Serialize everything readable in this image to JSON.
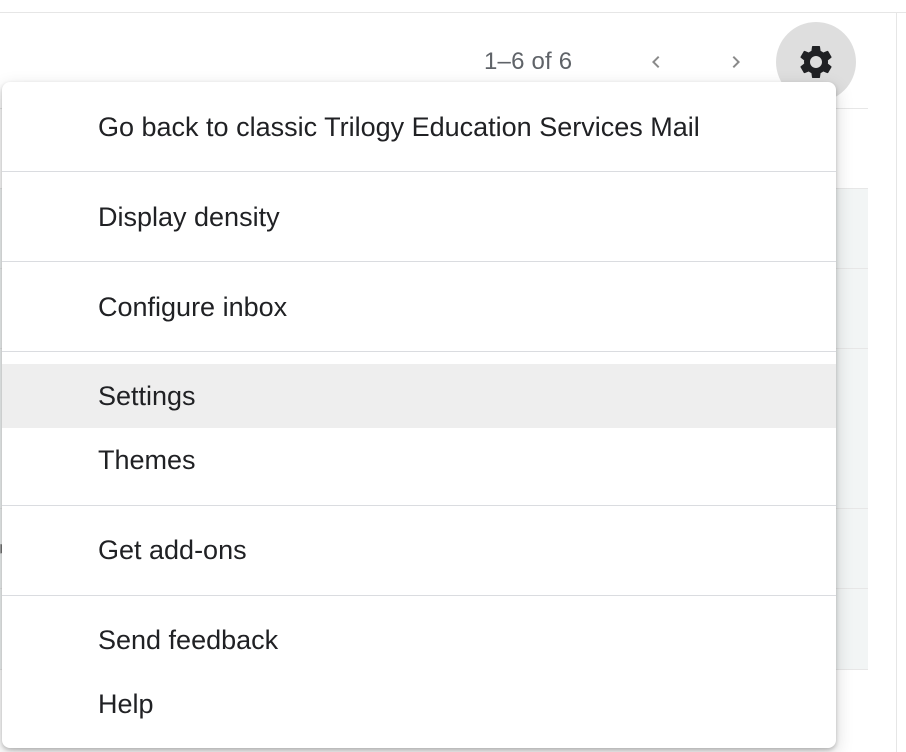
{
  "toolbar": {
    "pagination_label": "1–6 of 6",
    "prev_icon": "chevron-left-icon",
    "next_icon": "chevron-right-icon",
    "settings_icon": "gear-icon"
  },
  "settings_menu": {
    "items": [
      {
        "label": "Go back to classic Trilogy Education Services Mail"
      },
      {
        "label": "Display density"
      },
      {
        "label": "Configure inbox"
      },
      {
        "label": "Settings",
        "highlighted": true
      },
      {
        "label": "Themes"
      },
      {
        "label": "Get add-ons"
      },
      {
        "label": "Send feedback"
      },
      {
        "label": "Help"
      }
    ]
  },
  "colors": {
    "menu_text": "#202124",
    "highlight_bg": "#eeeeee",
    "gear_button_bg": "#dedede",
    "pager_text": "#5f6368"
  }
}
